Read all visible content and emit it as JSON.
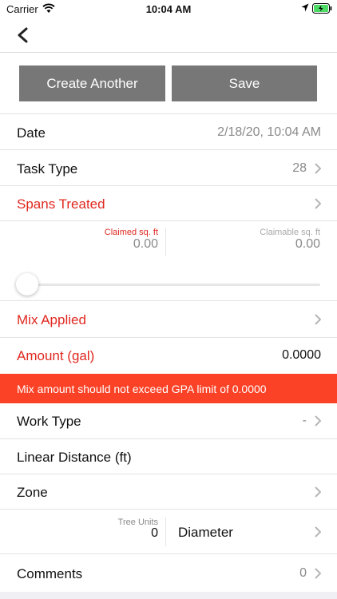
{
  "status_bar": {
    "carrier": "Carrier",
    "time": "10:04 AM",
    "battery_color": "#4cd964"
  },
  "nav": {
    "back_icon": "chevron-left-icon"
  },
  "actions": {
    "create_another": "Create Another",
    "save": "Save",
    "button_color": "#777777"
  },
  "form": {
    "date": {
      "label": "Date",
      "value": "2/18/20, 10:04 AM"
    },
    "task_type": {
      "label": "Task Type",
      "value": "28"
    },
    "spans_treated": {
      "label": "Spans Treated"
    },
    "claimed_sqft": {
      "label": "Claimed sq. ft",
      "value": "0.00"
    },
    "claimable_sqft": {
      "label": "Claimable sq. ft",
      "value": "0.00"
    },
    "slider": {
      "level": 0
    },
    "mix_applied": {
      "label": "Mix Applied"
    },
    "amount": {
      "label": "Amount (gal)",
      "value": "0.0000"
    },
    "warning": "Mix amount should not exceed GPA limit of 0.0000",
    "work_type": {
      "label": "Work Type",
      "value": "-"
    },
    "linear_distance": {
      "label": "Linear Distance (ft)"
    },
    "zone": {
      "label": "Zone"
    },
    "tree_units": {
      "label": "Tree Units",
      "value": "0"
    },
    "diameter": {
      "label": "Diameter"
    },
    "comments": {
      "label": "Comments",
      "value": "0"
    }
  },
  "colors": {
    "required_label": "#e0281f",
    "warning_background": "#fb4226"
  }
}
